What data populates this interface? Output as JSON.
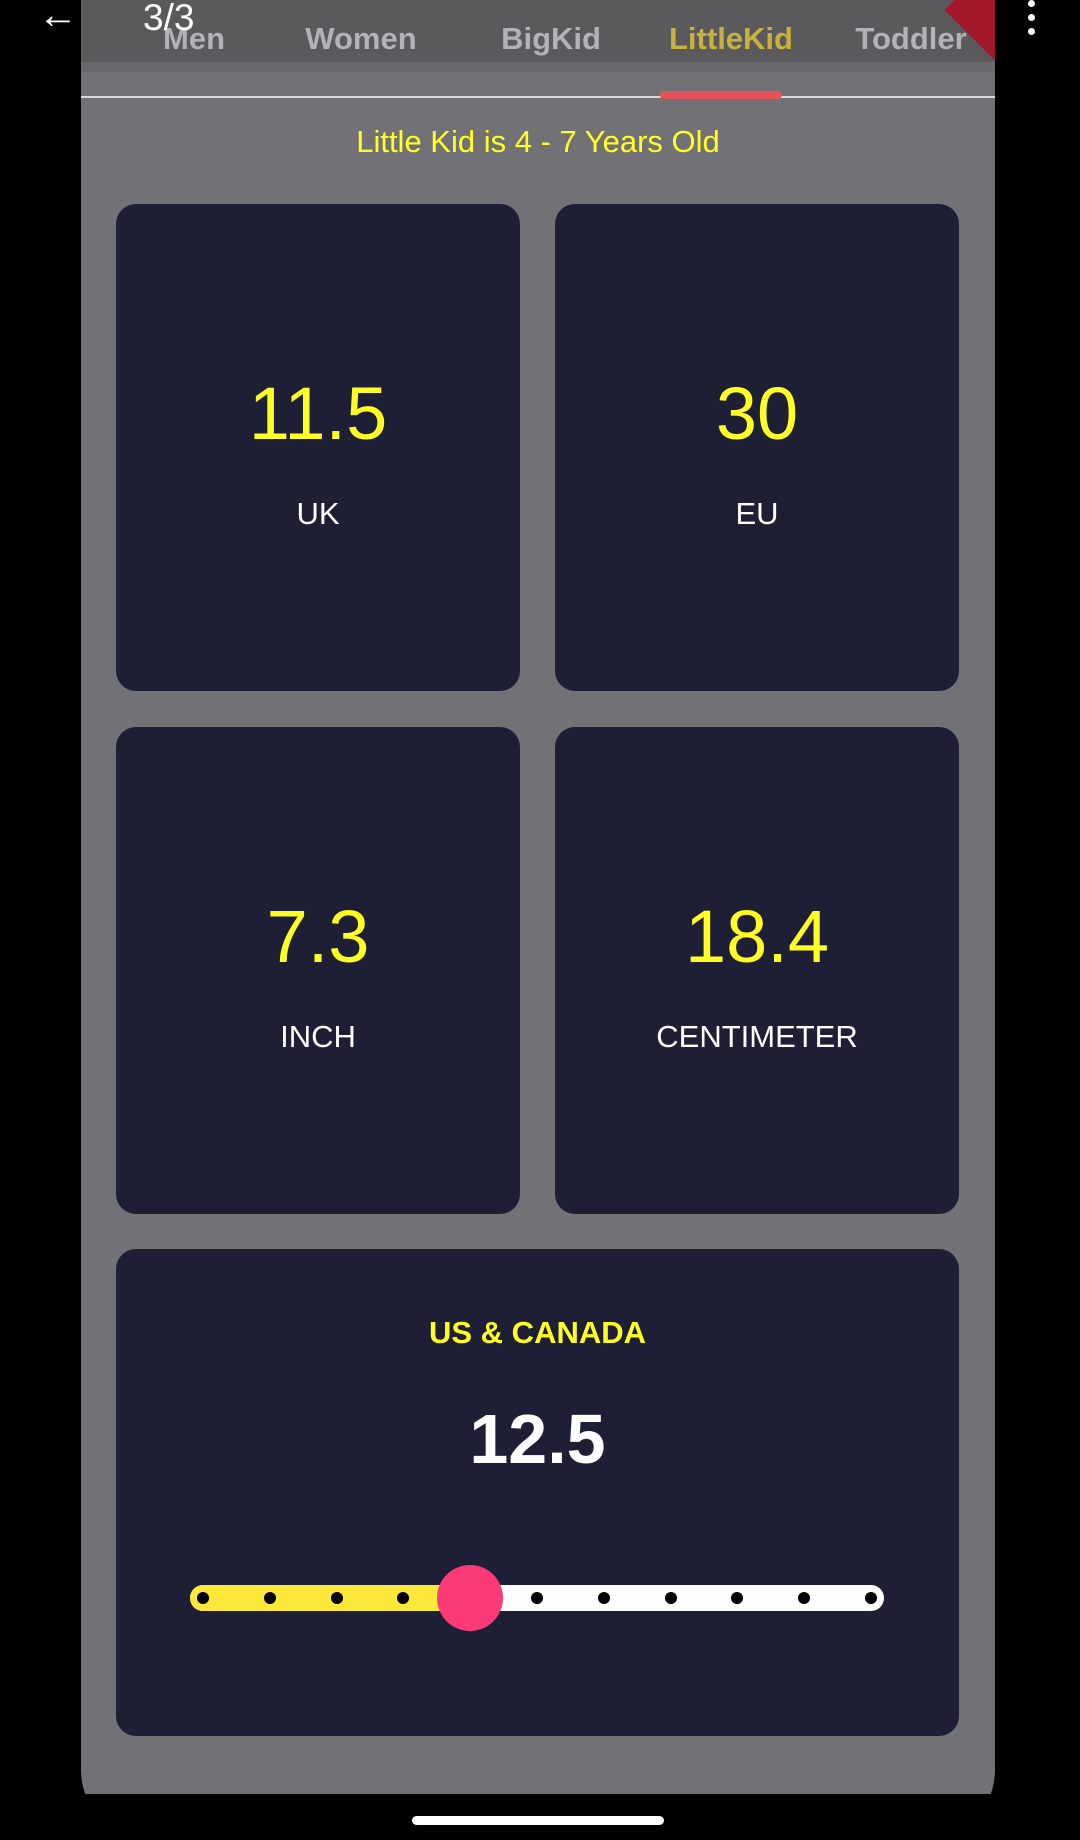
{
  "viewer": {
    "page_counter": "3/3"
  },
  "tabs": [
    {
      "label": "Men"
    },
    {
      "label": "Women"
    },
    {
      "label": "BigKid"
    },
    {
      "label": "LittleKid",
      "active": true
    },
    {
      "label": "Toddler"
    }
  ],
  "age_caption": "Little Kid is 4 - 7 Years Old",
  "cards": {
    "uk": {
      "value": "11.5",
      "unit": "UK"
    },
    "eu": {
      "value": "30",
      "unit": "EU"
    },
    "inch": {
      "value": "7.3",
      "unit": "INCH"
    },
    "cm": {
      "value": "18.4",
      "unit": "CENTIMETER"
    }
  },
  "us_canada": {
    "title": "US & CANADA",
    "value": "12.5",
    "slider": {
      "steps": 11,
      "selected_index": 4
    }
  },
  "colors": {
    "accent_yellow": "#ffff26",
    "active_tab": "#c9b13b",
    "indicator": "#e8525a",
    "card_bg": "#1e1f35",
    "screen_bg": "#727175",
    "thumb": "#fb3a77",
    "slider_fill": "#fce83a"
  }
}
